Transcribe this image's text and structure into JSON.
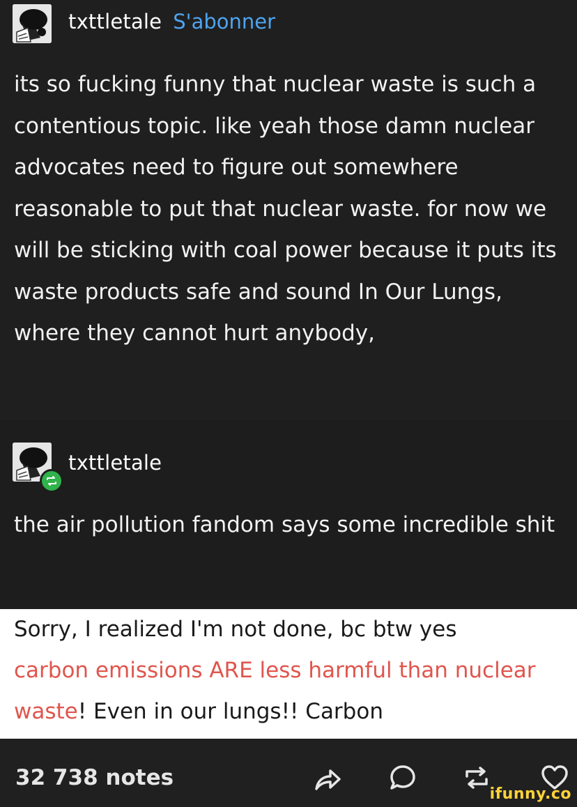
{
  "post": {
    "username": "txttletale",
    "follow_label": "S'abonner",
    "body": "its so fucking funny that nuclear waste is such a contentious topic. like yeah those damn nuclear advocates need to figure out somewhere reasonable to put that nuclear waste. for now we will  be sticking with coal power because it puts its waste products safe and sound In Our Lungs, where they cannot hurt anybody,"
  },
  "reblog": {
    "username": "txttletale",
    "body": "the air pollution fandom says some incredible shit"
  },
  "reply": {
    "line_start": "Sorry, I realized I'm not done, bc btw yes",
    "highlight": "carbon emissions ARE less harmful than nuclear waste",
    "line_end": "! Even in our lungs!! Carbon",
    "highlight_color": "#e0554d"
  },
  "footer": {
    "notes": "32 738 notes",
    "icons": [
      "share-icon",
      "reply-icon",
      "reblog-icon",
      "like-icon"
    ]
  },
  "watermark": "ifunny.co",
  "colors": {
    "background": "#1f1f1f",
    "follow": "#4ea4f0",
    "reblog_badge": "#2fb34a",
    "watermark": "#ffd23a"
  }
}
